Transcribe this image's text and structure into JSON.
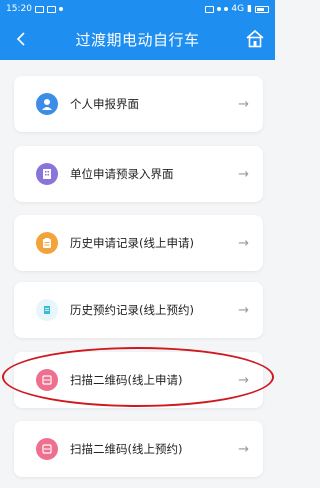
{
  "status_bar": {
    "time": "15:20",
    "signal_label": "4G"
  },
  "header": {
    "title": "过渡期电动自行车"
  },
  "menu": [
    {
      "label": "个人申报界面",
      "icon": "person-icon",
      "color": "#3d8de6"
    },
    {
      "label": "单位申请预录入界面",
      "icon": "building-icon",
      "color": "#8b74d9"
    },
    {
      "label": "历史申请记录(线上申请)",
      "icon": "clipboard-icon",
      "color": "#f2a33a"
    },
    {
      "label": "历史预约记录(线上预约)",
      "icon": "document-icon",
      "color": "#38b9d4"
    },
    {
      "label": "扫描二维码(线上申请)",
      "icon": "qr-scan-icon",
      "color": "#ee6f8e"
    },
    {
      "label": "扫描二维码(线上预约)",
      "icon": "qr-scan-icon",
      "color": "#ee6f8e"
    }
  ],
  "arrow_glyph": "→",
  "highlight_color": "#d0191f"
}
